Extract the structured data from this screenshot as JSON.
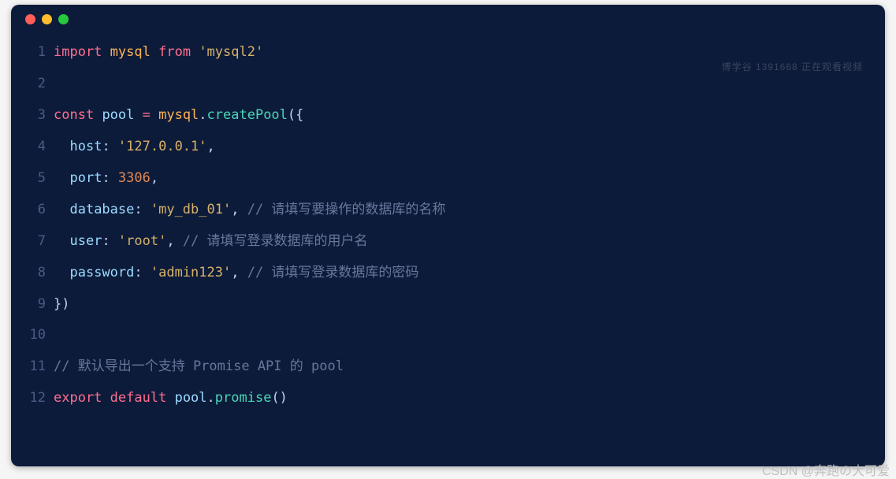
{
  "window": {
    "traffic_lights": [
      "red",
      "yellow",
      "green"
    ]
  },
  "watermark": "博学谷 1391668 正在观看视频",
  "credit": "CSDN @奔跑の大可爱",
  "code": {
    "lines": {
      "1": {
        "num": "1"
      },
      "2": {
        "num": "2"
      },
      "3": {
        "num": "3"
      },
      "4": {
        "num": "4"
      },
      "5": {
        "num": "5"
      },
      "6": {
        "num": "6"
      },
      "7": {
        "num": "7"
      },
      "8": {
        "num": "8"
      },
      "9": {
        "num": "9"
      },
      "10": {
        "num": "10"
      },
      "11": {
        "num": "11"
      },
      "12": {
        "num": "12"
      }
    },
    "tokens": {
      "import": "import",
      "from": "from",
      "const": "const",
      "export": "export",
      "default": "default",
      "mysql": "mysql",
      "mysql2_str": "'mysql2'",
      "pool": "pool",
      "eq": " = ",
      "createPool": "createPool",
      "promise": "promise",
      "open_call": "({",
      "close_call": "})",
      "dot": ".",
      "parens": "()",
      "comma": ",",
      "colon": ": ",
      "host": "host",
      "host_val": "'127.0.0.1'",
      "port": "port",
      "port_val": "3306",
      "database": "database",
      "database_val": "'my_db_01'",
      "user": "user",
      "user_val": "'root'",
      "password": "password",
      "password_val": "'admin123'",
      "comment_db": " // 请填写要操作的数据库的名称",
      "comment_user": " // 请填写登录数据库的用户名",
      "comment_pwd": " // 请填写登录数据库的密码",
      "comment_export": "// 默认导出一个支持 Promise API 的 pool"
    }
  }
}
